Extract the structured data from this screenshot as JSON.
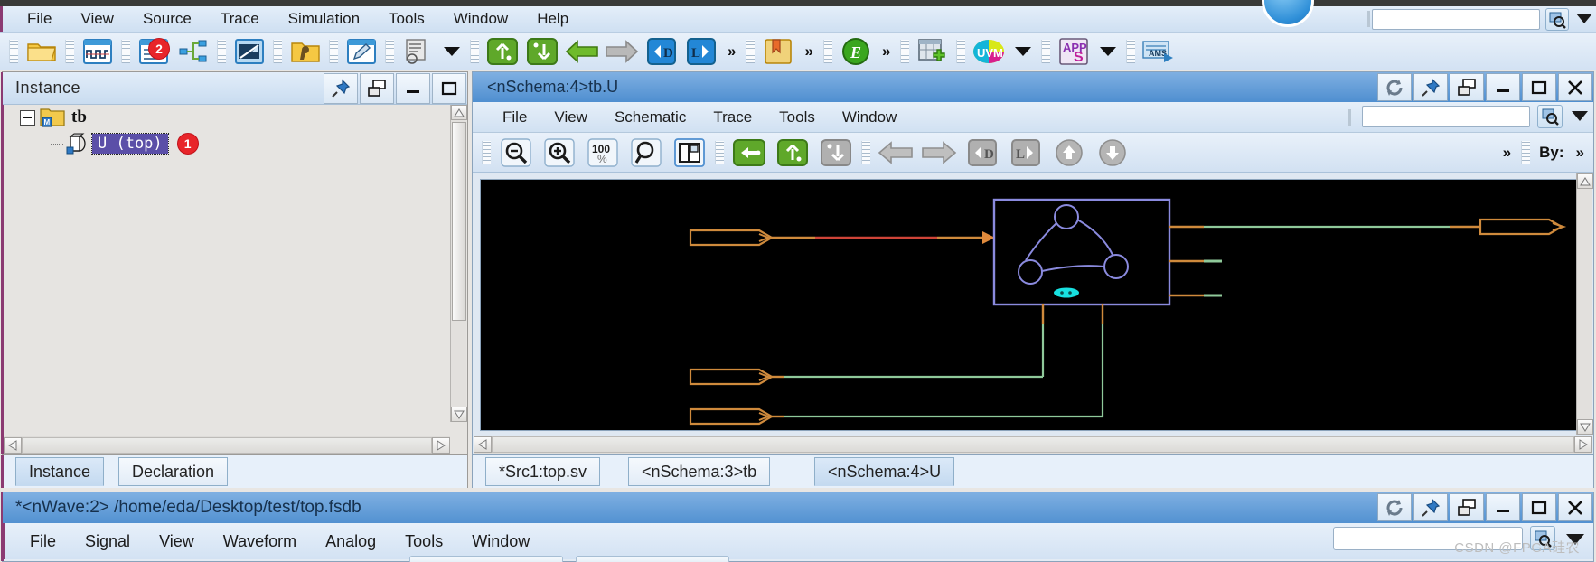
{
  "app": {
    "menu": [
      "File",
      "View",
      "Source",
      "Trace",
      "Simulation",
      "Tools",
      "Window",
      "Help"
    ],
    "search_value": "",
    "toolbar_badges": [
      {
        "label": "2",
        "on": "source-browser-icon"
      }
    ],
    "toolbar_icons": [
      "open-folder-icon",
      "waveform-window-icon",
      "source-browser-icon",
      "hierarchy-icon",
      "schematic-window-icon",
      "open-design-folder-icon",
      "edit-source-icon",
      "list-window-icon",
      "dropdown-caret-icon",
      "scope-up-icon",
      "scope-down-icon",
      "back-arrow-icon",
      "forward-arrow-icon",
      "driver-icon",
      "load-icon",
      "more-icon",
      "bookmark-icon",
      "more2-icon",
      "expression-icon",
      "more3-icon",
      "add-window-icon",
      "uvm-icon",
      "uvm-caret-icon",
      "apps-icon",
      "apps-caret-icon",
      "ams-icon"
    ],
    "search_icon": "search-icon",
    "caret_icon": "chevron-down-icon"
  },
  "instance_panel": {
    "title": "Instance",
    "controls": [
      "pin-icon",
      "undock-icon",
      "minimize-icon",
      "maximize-icon"
    ],
    "tree": [
      {
        "label": "tb",
        "icon": "module-folder-icon",
        "expander": "minus-box-icon",
        "level": 0,
        "selected": false
      },
      {
        "label": "U (top)",
        "icon": "instance-icon",
        "level": 1,
        "selected": true,
        "badge": "1"
      }
    ],
    "tabs": [
      {
        "label": "Instance",
        "active": true
      },
      {
        "label": "Declaration",
        "active": false
      }
    ]
  },
  "schematic_window": {
    "title": "<nSchema:4>tb.U",
    "controls": [
      "refresh-icon",
      "pin-icon",
      "undock-icon",
      "minimize-icon",
      "maximize-icon",
      "close-icon"
    ],
    "menu": [
      "File",
      "View",
      "Schematic",
      "Trace",
      "Tools",
      "Window"
    ],
    "search_value": "",
    "toolbar_icons": [
      "zoom-out-icon",
      "zoom-in-icon",
      "zoom-100-icon",
      "zoom-fit-icon",
      "split-view-icon",
      "back-trace-icon",
      "scope-up-icon",
      "scope-down-icon",
      "prev-arrow-icon",
      "next-arrow-icon",
      "driver-icon",
      "load-icon",
      "up-arrow-icon",
      "down-arrow-icon"
    ],
    "toolbar_more": "»",
    "by_label": "By:",
    "by_more": "»",
    "tabs": [
      {
        "label": "*Src1:top.sv",
        "active": false
      },
      {
        "label": "<nSchema:3>tb",
        "active": false
      },
      {
        "label": "<nSchema:4>U",
        "active": true
      }
    ],
    "canvas": {
      "background": "#000000",
      "block_border": "#8f8fe0",
      "port_color": "#d08a3c",
      "wire_green": "#8fc99a",
      "wire_red": "#d0483c",
      "logo_color": "#7c7ce0",
      "label_color": "#18e8e8",
      "input_ports": 3,
      "output_ports": 1,
      "stub_outputs": 2
    }
  },
  "wave_window": {
    "title": "*<nWave:2> /home/eda/Desktop/test/top.fsdb",
    "controls": [
      "refresh-icon",
      "pin-icon",
      "undock-icon",
      "minimize-icon",
      "maximize-icon",
      "close-icon"
    ],
    "menu": [
      "File",
      "Signal",
      "View",
      "Waveform",
      "Analog",
      "Tools",
      "Window"
    ],
    "search_value": "",
    "search_icon": "search-icon",
    "caret_icon": "chevron-down-icon"
  },
  "watermark": "CSDN @FPGA硅农",
  "colors": {
    "title_active": "#4f8fd0",
    "selection": "#5b4fa8",
    "badge_red": "#e8252a",
    "accent_purple": "#8b3a72"
  }
}
